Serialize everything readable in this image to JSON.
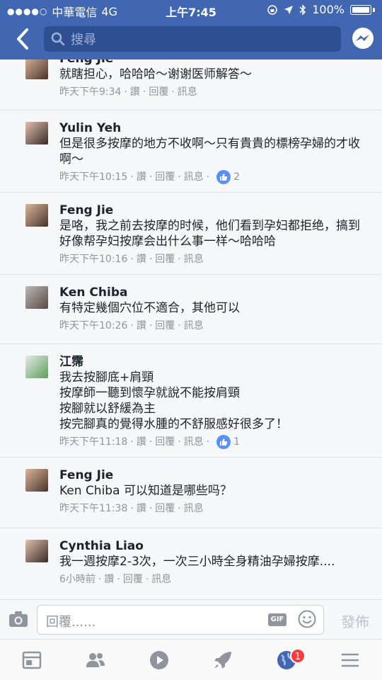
{
  "status_bar": {
    "carrier": "中華電信",
    "network": "4G",
    "time": "上午7:45",
    "battery": "100%"
  },
  "header": {
    "search_placeholder": "搜尋"
  },
  "comments": [
    {
      "name": "Feng Jie",
      "text": "就瞎担心，哈哈哈～谢谢医师解答～",
      "time": "昨天下午9:34",
      "actions": [
        "讚",
        "回覆",
        "訊息"
      ],
      "likes": ""
    },
    {
      "name": "Yulin Yeh",
      "text": "但是很多按摩的地方不收啊～只有貴貴的標榜孕婦的才收啊～",
      "time": "昨天下午10:15",
      "actions": [
        "讚",
        "回覆",
        "訊息"
      ],
      "likes": "2"
    },
    {
      "name": "Feng Jie",
      "text": "是咯，我之前去按摩的时候，他们看到孕妇都拒绝，搞到好像帮孕妇按摩会出什么事一样～哈哈哈",
      "time": "昨天下午10:16",
      "actions": [
        "讚",
        "回覆",
        "訊息"
      ],
      "likes": ""
    },
    {
      "name": "Ken Chiba",
      "text": "有特定幾個穴位不適合，其他可以",
      "time": "昨天下午10:26",
      "actions": [
        "讚",
        "回覆",
        "訊息"
      ],
      "likes": ""
    },
    {
      "name": "江霈",
      "lines": [
        "我去按腳底+肩頸",
        "按摩師一聽到懷孕就說不能按肩頸",
        "按腳就以舒緩為主",
        "按完腳真的覺得水腫的不舒服感好很多了！"
      ],
      "time": "昨天下午11:18",
      "actions": [
        "讚",
        "回覆",
        "訊息"
      ],
      "likes": "1"
    },
    {
      "name": "Feng Jie",
      "text": "Ken Chiba 可以知道是哪些吗？",
      "time": "昨天下午11:38",
      "actions": [
        "讚",
        "回覆",
        "訊息"
      ],
      "likes": ""
    },
    {
      "name": "Cynthia Liao",
      "text": "我一週按摩2-3次，一次三小時全身精油孕婦按摩....",
      "time": "6小時前",
      "actions": [
        "讚",
        "回覆",
        "訊息"
      ],
      "likes": ""
    }
  ],
  "reply_bar": {
    "placeholder": "回覆......",
    "gif_label": "GIF",
    "post_label": "發佈"
  },
  "tab_bar": {
    "notification_count": "1"
  },
  "colors": {
    "header": "#4267b2",
    "like": "#5890ff",
    "badge": "#fa3e3e"
  }
}
